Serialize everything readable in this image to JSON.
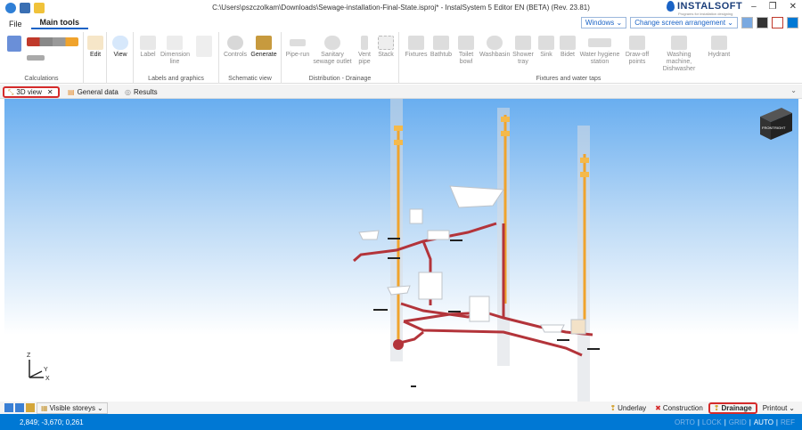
{
  "window": {
    "title": "C:\\Users\\pszczolkam\\Downloads\\Sewage-installation-Final-State.isproj* - InstalSystem 5 Editor EN (BETA) (Rev. 23.81)",
    "logo_text": "INSTALSOFT",
    "logo_sub": "Programs for installation designing",
    "minimize": "–",
    "restore": "❐",
    "close": "✕"
  },
  "menu": {
    "file": "File",
    "main_tools": "Main tools"
  },
  "toolbar_right": {
    "windows": "Windows ⌄",
    "screen_arrangement": "Change screen arrangement ⌄"
  },
  "ribbon": {
    "groups": {
      "calculations": "Calculations",
      "labels_graphics": "Labels and graphics",
      "schematic_view": "Schematic view",
      "distribution_drainage": "Distribution - Drainage",
      "fixtures_taps": "Fixtures and water taps"
    },
    "buttons": {
      "edit": "Edit",
      "view": "View",
      "label": "Label",
      "dimension_line": "Dimension line",
      "controls": "Controls",
      "generate": "Generate",
      "pipe_run": "Pipe-run",
      "sanitary_sewage_outlet": "Sanitary sewage outlet",
      "vent_pipe": "Vent pipe",
      "stack": "Stack",
      "fixtures": "Fixtures",
      "bathtub": "Bathtub",
      "toilet_bowl": "Toilet bowl",
      "washbasin": "Washbasin",
      "shower_tray": "Shower tray",
      "sink": "Sink",
      "bidet": "Bidet",
      "water_hygiene_station": "Water hygiene station",
      "draw_off_points": "Draw-off points",
      "washing_machine": "Washing machine, Dishwasher",
      "hydrant": "Hydrant"
    }
  },
  "tabs": [
    {
      "label": "3D view",
      "close": "✕"
    },
    {
      "label": "General data"
    },
    {
      "label": "Results"
    }
  ],
  "viewcube": {
    "front": "FRONT",
    "right": "RIGHT"
  },
  "axes": {
    "z": "Z",
    "y": "Y",
    "x": "X"
  },
  "bottom": {
    "visible_storeys": "Visible storeys",
    "underlay": "Underlay",
    "construction": "Construction",
    "drainage": "Drainage",
    "printout": "Printout"
  },
  "status": {
    "coords": "2,849; -3,670; 0,261",
    "flags": [
      "ORTO",
      "LOCK",
      "GRID",
      "AUTO",
      "REF"
    ]
  },
  "colors": {
    "accent": "#0078d4",
    "pipe": "#b3343a",
    "vent": "#f0a32c",
    "highlight": "#d52b2b"
  }
}
